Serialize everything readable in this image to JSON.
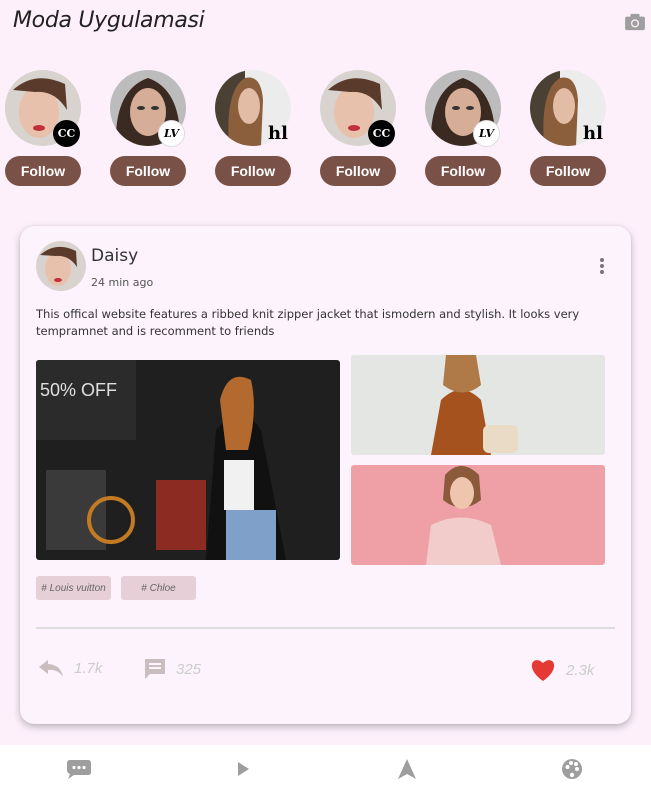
{
  "header": {
    "title": "Moda Uygulamasi",
    "camera_icon": "camera-icon"
  },
  "stories": [
    {
      "avatar": "woman-red-lips",
      "badge": "CC",
      "follow_label": "Follow"
    },
    {
      "avatar": "woman-smokey-eyes",
      "badge": "LV",
      "follow_label": "Follow"
    },
    {
      "avatar": "woman-long-hair",
      "badge": "hl",
      "follow_label": "Follow"
    },
    {
      "avatar": "woman-red-lips",
      "badge": "CC",
      "follow_label": "Follow"
    },
    {
      "avatar": "woman-smokey-eyes",
      "badge": "LV",
      "follow_label": "Follow"
    },
    {
      "avatar": "woman-long-hair",
      "badge": "hl",
      "follow_label": "Follow"
    }
  ],
  "post": {
    "author": "Daisy",
    "time": "24 min ago",
    "text": "This offical website features a ribbed knit zipper jacket that ismodern and stylish. It looks very tempramnet and is recomment to friends",
    "main_image_overlay": "50% OFF",
    "tags": [
      "# Louis vuitton",
      "# Chloe"
    ],
    "actions": {
      "shares": "1.7k",
      "comments": "325",
      "likes": "2.3k"
    }
  },
  "colors": {
    "background": "#fdf0fb",
    "follow_button": "#7a5147",
    "like": "#e53935",
    "tag_bg": "#e6cfd6"
  },
  "bottom_nav": [
    "chat-bubble-icon",
    "play-icon",
    "navigation-arrow-icon",
    "palette-icon"
  ]
}
